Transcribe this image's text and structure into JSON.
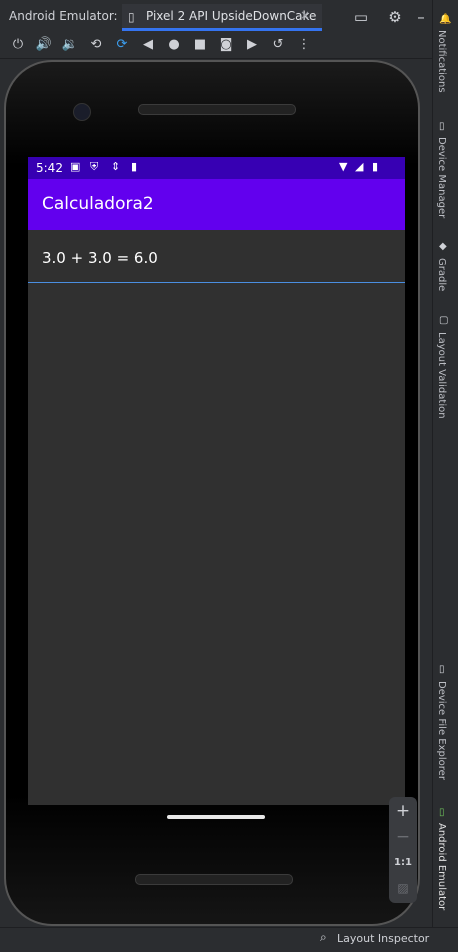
{
  "titlebar": {
    "app_label": "Android Emulator:",
    "tab_label": "Pixel 2 API UpsideDownCake",
    "tab_close": "×",
    "icons": [
      "window-icon",
      "gear-icon",
      "minimize-icon"
    ]
  },
  "toolbar": {
    "buttons": [
      "power",
      "volume-up",
      "volume-down",
      "rotate-left",
      "rotate-right",
      "back",
      "home",
      "overview",
      "screenshot",
      "screen-record",
      "snapshot",
      "more"
    ]
  },
  "sidebar": {
    "items": [
      {
        "label": "Notifications",
        "icon": "bell-icon"
      },
      {
        "label": "Device Manager",
        "icon": "device-icon"
      },
      {
        "label": "Gradle",
        "icon": "elephant-icon"
      },
      {
        "label": "Layout Validation",
        "icon": "layout-icon"
      },
      {
        "label": "Device File Explorer",
        "icon": "file-icon"
      },
      {
        "label": "Android Emulator",
        "icon": "emulator-icon"
      }
    ]
  },
  "statusbar": {
    "layout_inspector": "Layout Inspector"
  },
  "phone": {
    "clock": "5:42",
    "app_title": "Calculadora2",
    "result": "3.0 + 3.0 = 6.0"
  },
  "zoom": {
    "plus": "+",
    "minus": "−",
    "one_to_one": "1:1"
  },
  "colors": {
    "status_bar": "#3700b3",
    "app_bar": "#6200ee",
    "screen_bg": "#303030",
    "accent_line": "#4a8ee0"
  }
}
